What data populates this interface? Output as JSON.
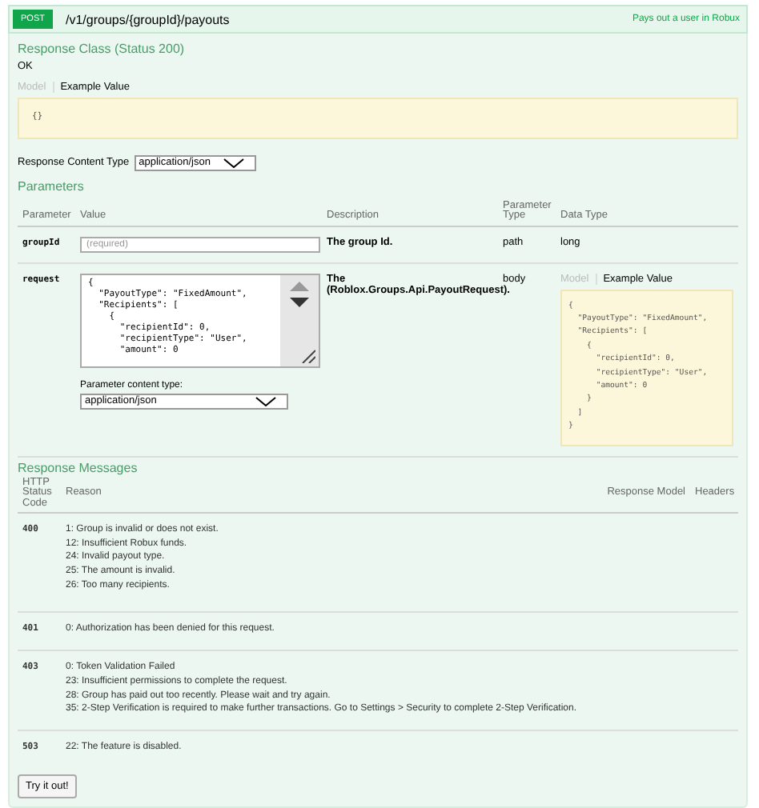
{
  "operation": {
    "method": "POST",
    "path": "/v1/groups/{groupId}/payouts",
    "summary": "Pays out a user in Robux"
  },
  "response_class": {
    "title": "Response Class (Status 200)",
    "status_text": "OK",
    "tabs": [
      {
        "label": "Model",
        "selected": false
      },
      {
        "label": "Example Value",
        "selected": true
      }
    ],
    "example": "{}"
  },
  "response_content_type": {
    "label": "Response Content Type",
    "value": "application/json"
  },
  "parameters": {
    "title": "Parameters",
    "columns": [
      "Parameter",
      "Value",
      "Description",
      "Parameter Type",
      "Data Type"
    ],
    "rows": [
      {
        "kind": "text",
        "name": "groupId",
        "placeholder": "(required)",
        "description": "The group Id.",
        "parameter_type": "path",
        "data_type": "long"
      },
      {
        "kind": "body",
        "name": "request",
        "value": "{\n  \"PayoutType\": \"FixedAmount\",\n  \"Recipients\": [\n    {\n      \"recipientId\": 0,\n      \"recipientType\": \"User\",\n      \"amount\": 0",
        "content_type_label": "Parameter content type:",
        "content_type": "application/json",
        "description": "The (Roblox.Groups.Api.PayoutRequest).",
        "parameter_type": "body",
        "tabs": [
          {
            "label": "Model",
            "selected": false
          },
          {
            "label": "Example Value",
            "selected": true
          }
        ],
        "example": "{\n  \"PayoutType\": \"FixedAmount\",\n  \"Recipients\": [\n    {\n      \"recipientId\": 0,\n      \"recipientType\": \"User\",\n      \"amount\": 0\n    }\n  ]\n}"
      }
    ]
  },
  "response_messages": {
    "title": "Response Messages",
    "columns": [
      "HTTP Status Code",
      "Reason",
      "Response Model",
      "Headers"
    ],
    "rows": [
      {
        "code": "400",
        "reasons": [
          "1: Group is invalid or does not exist.",
          "12: Insufficient Robux funds.",
          "24: Invalid payout type.",
          "25: The amount is invalid.",
          "26: Too many recipients."
        ]
      },
      {
        "code": "401",
        "reasons": [
          "0: Authorization has been denied for this request."
        ]
      },
      {
        "code": "403",
        "reasons": [
          "0: Token Validation Failed",
          "23: Insufficient permissions to complete the request.",
          "28: Group has paid out too recently. Please wait and try again.",
          "35: 2-Step Verification is required to make further transactions. Go to Settings > Security to complete 2-Step Verification."
        ]
      },
      {
        "code": "503",
        "reasons": [
          "22: The feature is disabled."
        ]
      }
    ]
  },
  "button": "Try it out!"
}
